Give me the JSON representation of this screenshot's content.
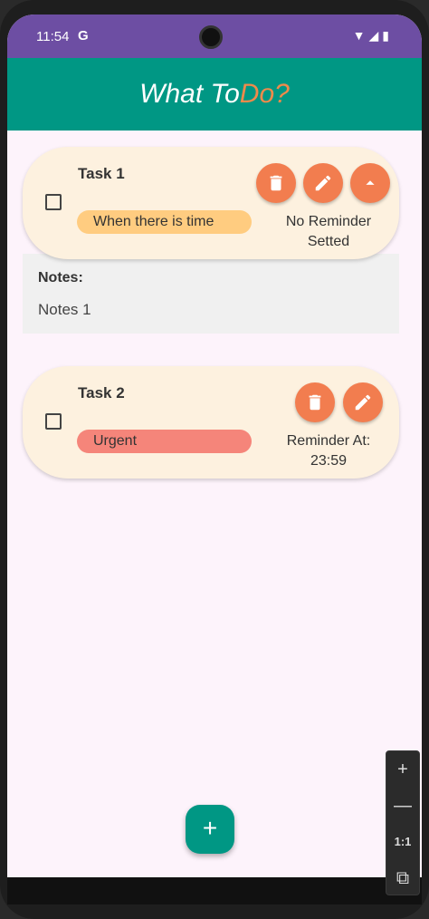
{
  "status_bar": {
    "time": "11:54",
    "g_label": "G",
    "icons": "▼◢▮"
  },
  "app_bar": {
    "title_main": "What To",
    "title_accent": "Do?"
  },
  "tasks": [
    {
      "title": "Task 1",
      "tag": "When there is time",
      "reminder_line1": "No Reminder",
      "reminder_line2": "Setted",
      "notes_label": "Notes:",
      "notes_text": "Notes 1"
    },
    {
      "title": "Task 2",
      "tag": "Urgent",
      "reminder_line1": "Reminder At:",
      "reminder_line2": "23:59"
    }
  ],
  "icons": {
    "delete": "trash-icon",
    "edit": "pencil-icon",
    "collapse": "chevron-up-icon",
    "add": "plus-icon"
  },
  "fab_label": "+",
  "emulator_zoom": {
    "plus": "+",
    "minus": "—",
    "ratio": "1:1",
    "fit": "⧉"
  },
  "colors": {
    "status_bar": "#6d4ea3",
    "app_bar": "#009784",
    "accent": "#f08a4b",
    "card": "#fdf1df",
    "tag_time": "#ffcc80",
    "tag_urgent": "#f5857a",
    "button": "#f27d4f"
  }
}
